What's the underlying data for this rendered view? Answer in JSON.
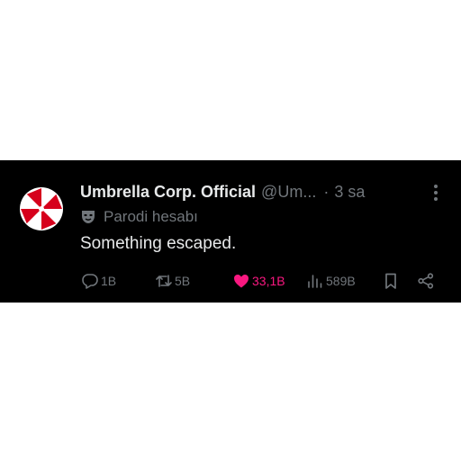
{
  "tweet": {
    "author_name": "Umbrella Corp. Official",
    "handle": "@Um...",
    "separator": "·",
    "time": "3 sa",
    "badge_label": "Parodi hesabı",
    "text": "Something escaped.",
    "colors": {
      "background": "#000000",
      "text": "#e7e9ea",
      "muted": "#71767b",
      "like": "#f91880",
      "logo_red": "#d6001c"
    }
  },
  "actions": {
    "replies": "1B",
    "reposts": "5B",
    "likes": "33,1B",
    "views": "589B",
    "icons": [
      "reply-icon",
      "repost-icon",
      "like-icon-filled",
      "views-icon",
      "bookmark-icon",
      "share-icon"
    ]
  }
}
